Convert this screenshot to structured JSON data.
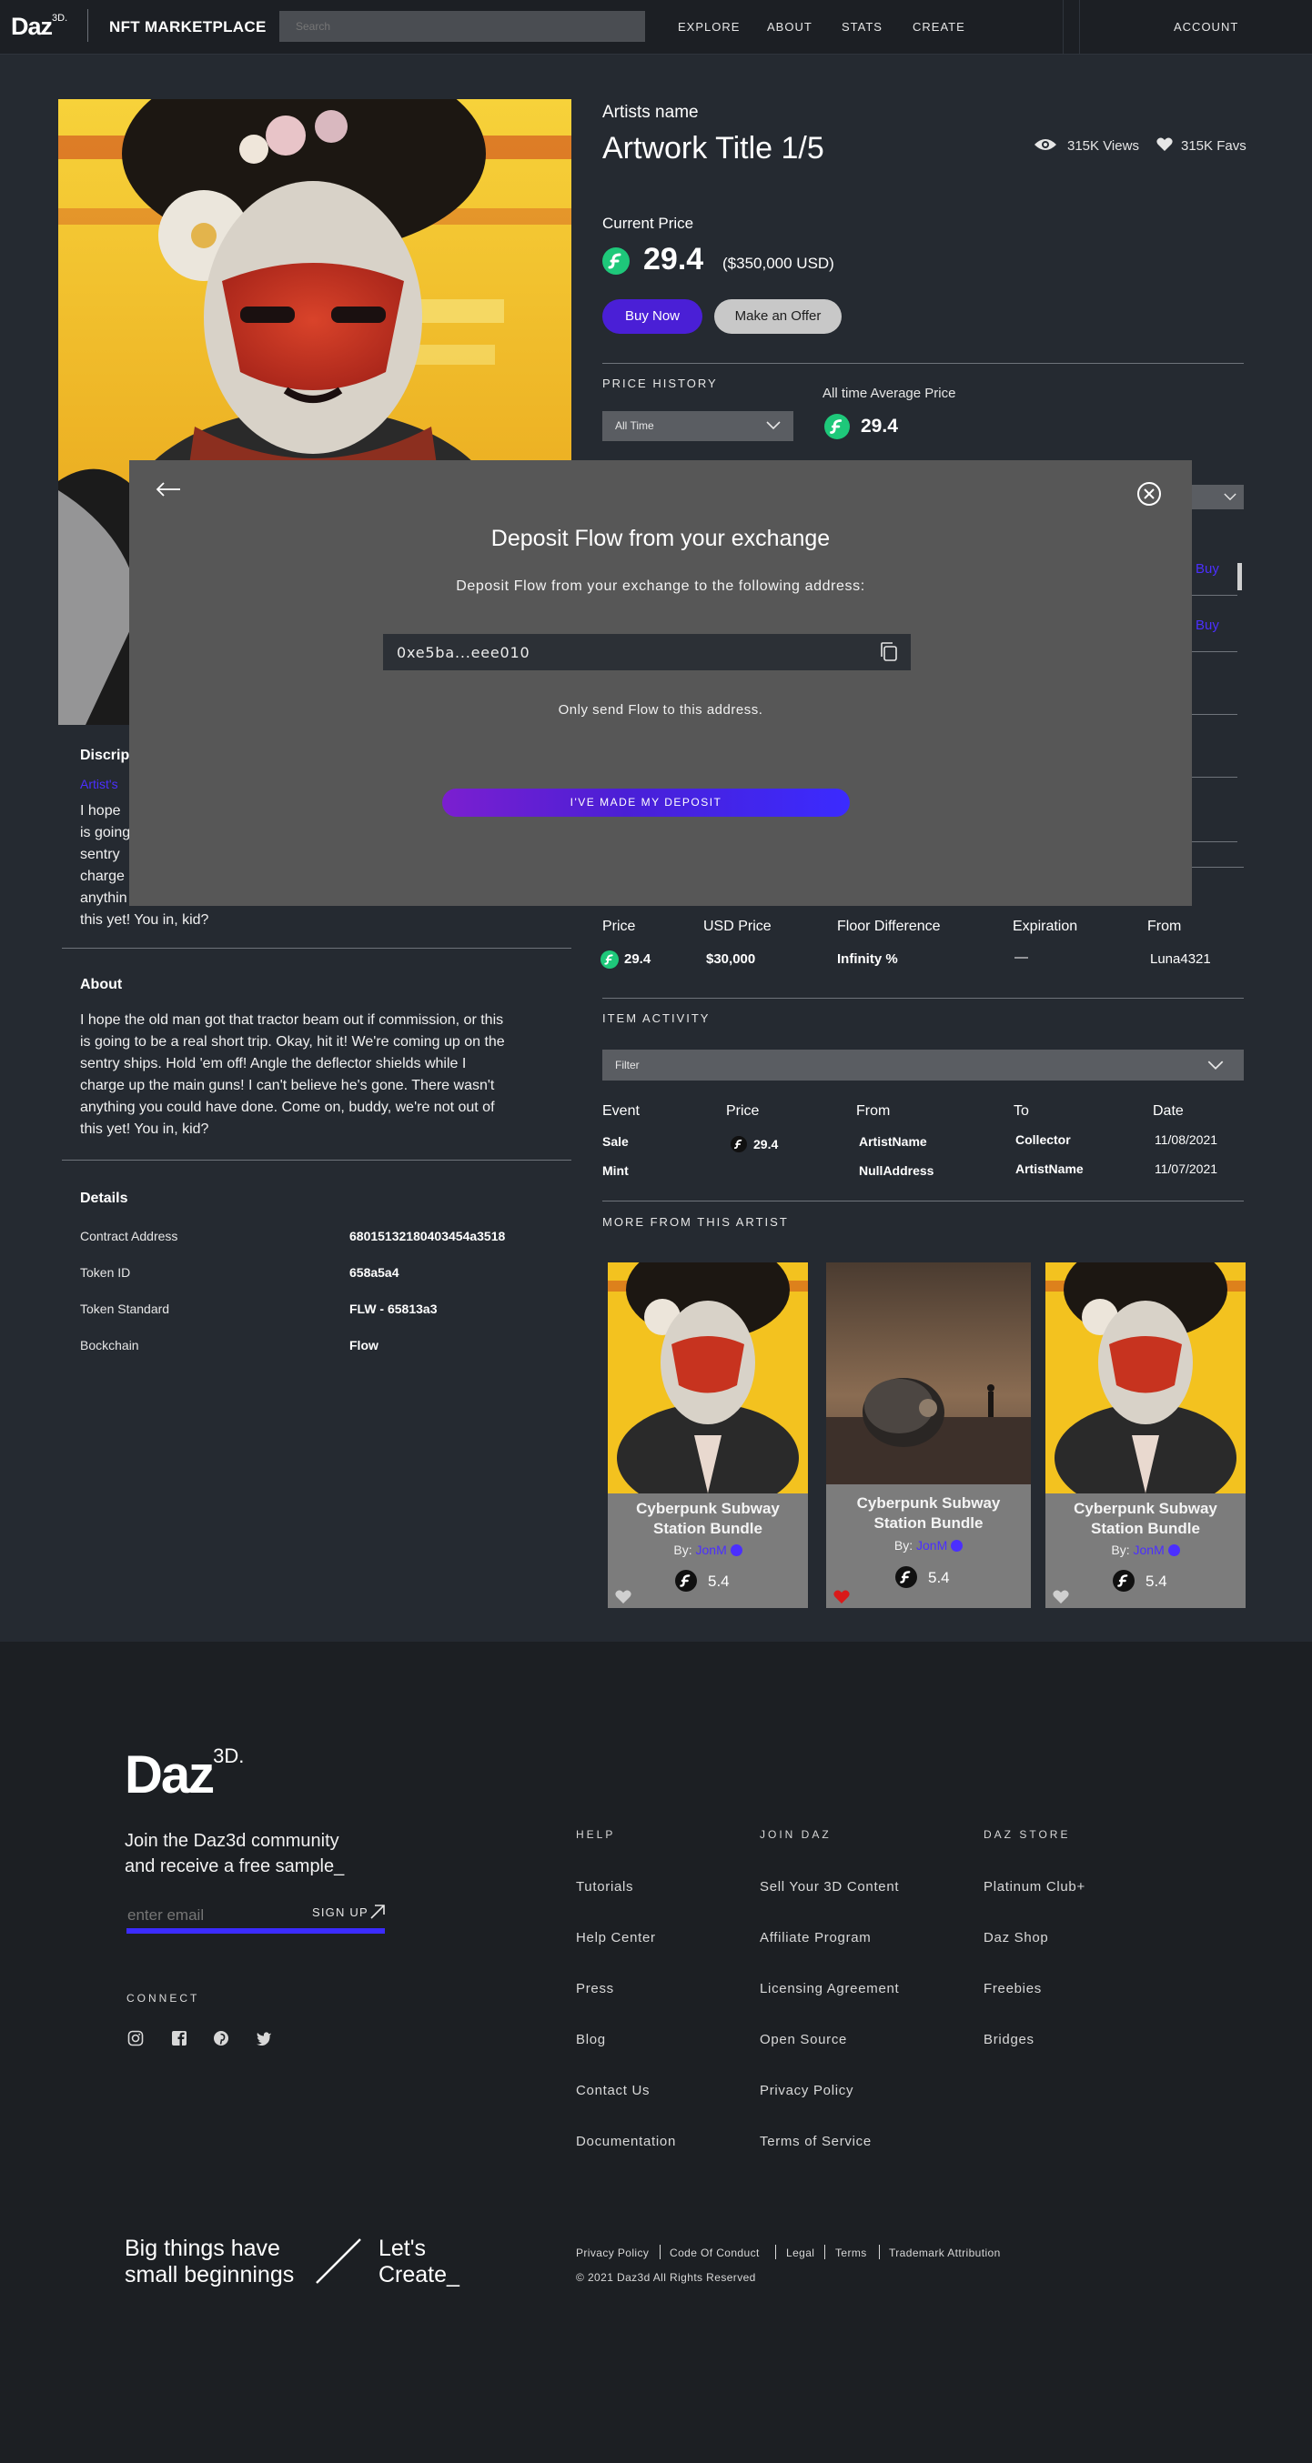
{
  "nav": {
    "logo": "Daz",
    "logo_sup": "3D.",
    "brand": "NFT MARKETPLACE",
    "search_placeholder": "Search",
    "items": [
      "EXPLORE",
      "ABOUT",
      "STATS",
      "CREATE"
    ],
    "account": "ACCOUNT"
  },
  "artwork": {
    "artist_name": "Artists name",
    "title": "Artwork Title 1/5",
    "views": "315K Views",
    "favs": "315K Favs",
    "current_price_label": "Current Price",
    "price": "29.4",
    "usd_price": "($350,000 USD)",
    "buy_now": "Buy Now",
    "make_offer": "Make an Offer"
  },
  "price_history": {
    "label": "PRICE HISTORY",
    "select_value": "All Time",
    "avg_label": "All time Average Price",
    "avg_value": "29.4"
  },
  "listings_partial": {
    "buy_1": "Buy",
    "buy_2": "Buy"
  },
  "offers": {
    "headers": [
      "Price",
      "USD Price",
      "Floor Difference",
      "Expiration",
      "From"
    ],
    "row": {
      "price": "29.4",
      "usd": "$30,000",
      "floor": "Infinity %",
      "expiration": "—",
      "from": "Luna4321"
    }
  },
  "item_activity": {
    "label": "ITEM ACTIVITY",
    "filter": "Filter",
    "headers": [
      "Event",
      "Price",
      "From",
      "To",
      "Date"
    ],
    "rows": [
      {
        "event": "Sale",
        "price": "29.4",
        "from": "ArtistName",
        "to": "Collector",
        "date": "11/08/2021"
      },
      {
        "event": "Mint",
        "price": "",
        "from": "NullAddress",
        "to": "ArtistName",
        "date": "11/07/2021"
      }
    ]
  },
  "more_from_artist": {
    "label": "MORE FROM THIS ARTIST",
    "cards": [
      {
        "title": "Cyberpunk Subway Station Bundle",
        "by": "By:",
        "author": "JonM",
        "price": "5.4",
        "fav": false
      },
      {
        "title": "Cyberpunk Subway Station Bundle",
        "by": "By:",
        "author": "JonM",
        "price": "5.4",
        "fav": true
      },
      {
        "title": "Cyberpunk Subway Station Bundle",
        "by": "By:",
        "author": "JonM",
        "price": "5.4",
        "fav": false
      }
    ]
  },
  "description": {
    "title_partial": "Discrip",
    "artist_partial": "Artist's",
    "lines_partial": [
      "I hope",
      "is going",
      "sentry",
      "charge",
      "anythin",
      "this yet! You in, kid?"
    ]
  },
  "about": {
    "title": "About",
    "lines": [
      "I hope the old man got that tractor beam out if commission, or this",
      "is going to be a real short trip. Okay, hit it! We're coming up on the",
      "sentry ships. Hold 'em off! Angle the deflector shields while I",
      "charge up the main guns! I can't believe he's gone. There wasn't",
      "anything you could have done. Come on, buddy, we're not out of",
      "this yet! You in, kid?"
    ]
  },
  "details": {
    "title": "Details",
    "rows": [
      {
        "label": "Contract Address",
        "value": "68015132180403454a3518"
      },
      {
        "label": "Token ID",
        "value": "658a5a4"
      },
      {
        "label": "Token Standard",
        "value": "FLW - 65813a3"
      },
      {
        "label": "Bockchain",
        "value": "Flow"
      }
    ]
  },
  "modal": {
    "title": "Deposit Flow from your exchange",
    "subtitle": "Deposit Flow from your exchange to the following address:",
    "address": "0xe5ba...eee010",
    "note": "Only send Flow to this address.",
    "cta": "I'VE MADE MY DEPOSIT"
  },
  "footer": {
    "logo": "Daz",
    "logo_sup": "3D.",
    "join_line1": "Join the Daz3d community",
    "join_line2": "and receive a free sample_",
    "email_placeholder": "enter email",
    "signup": "SIGN UP",
    "connect": "CONNECT",
    "columns": [
      {
        "head": "HELP",
        "links": [
          "Tutorials",
          "Help Center",
          "Press",
          "Blog",
          "Contact Us",
          "Documentation"
        ]
      },
      {
        "head": "JOIN DAZ",
        "links": [
          "Sell Your 3D Content",
          "Affiliate Program",
          "Licensing Agreement",
          "Open Source",
          "Privacy Policy",
          "Terms of Service"
        ]
      },
      {
        "head": "DAZ STORE",
        "links": [
          "Platinum Club+",
          "Daz Shop",
          "Freebies",
          "Bridges"
        ]
      }
    ],
    "tag_left_1": "Big things have",
    "tag_left_2": "small beginnings",
    "tag_right_1": "Let's",
    "tag_right_2": "Create_",
    "legal_links": [
      "Privacy Policy",
      "Code Of Conduct",
      "Legal",
      "Terms",
      "Trademark Attribution"
    ],
    "copyright": "© 2021 Daz3d All Rights Reserved"
  },
  "colors": {
    "accent": "#4a1fd6",
    "bg": "#252a31",
    "footer_bg": "#1c1f23",
    "coin": "#1ec87a",
    "modal": "#575757"
  }
}
